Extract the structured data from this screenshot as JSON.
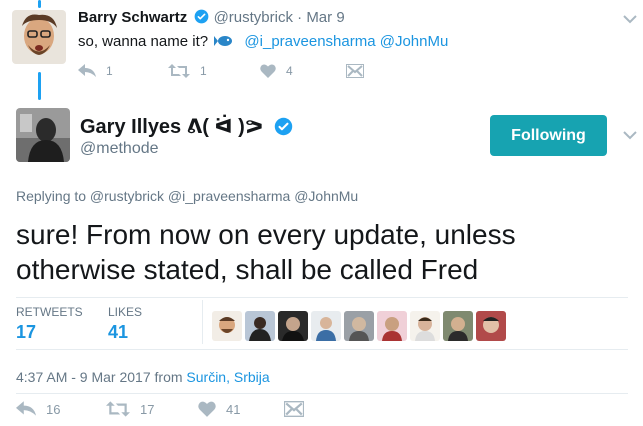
{
  "parent_tweet": {
    "name": "Barry Schwartz",
    "handle": "@rustybrick",
    "separator": "·",
    "date": "Mar 9",
    "text_before": "so, wanna name it?",
    "mentions": "@i_praveensharma @JohnMu",
    "reply_count": "1",
    "retweet_count": "1",
    "like_count": "4"
  },
  "main_tweet": {
    "name": "Gary Illyes ᕕ( ᐛ )ᕗ",
    "handle": "@methode",
    "follow_label": "Following",
    "replying_to": "Replying to @rustybrick @i_praveensharma @JohnMu",
    "text": "sure! From now on every update, unless otherwise stated, shall be called Fred",
    "retweets_label": "RETWEETS",
    "retweets_value": "17",
    "likes_label": "LIKES",
    "likes_value": "41",
    "timestamp": "4:37 AM - 9 Mar 2017 from ",
    "location": "Surčin, Srbija",
    "reply_count": "16",
    "retweet_count": "17",
    "like_count": "41"
  },
  "colors": {
    "link": "#1b95e0",
    "follow_button": "#17a3b1",
    "muted": "#657786",
    "icon": "#aab8c2"
  },
  "icons": [
    "verified-icon",
    "fish-emoji-icon",
    "reply-icon",
    "retweet-icon",
    "heart-icon",
    "dm-icon",
    "chevron-down-icon"
  ]
}
